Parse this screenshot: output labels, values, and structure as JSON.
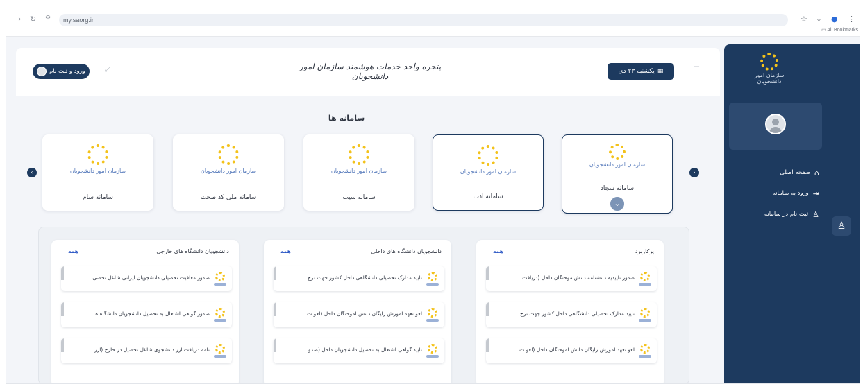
{
  "browser": {
    "url": "my.saorg.ir",
    "bookmarks_label": "All Bookmarks",
    "icons": [
      "arrow-right-icon",
      "reload-icon",
      "site-settings-icon",
      "star-icon",
      "download-icon",
      "profile-icon",
      "menu-icon"
    ]
  },
  "header": {
    "login_label": "ورود و ثبت نام",
    "title": "پنجره واحد خدمات هوشمند سازمان امور دانشجویان",
    "date_label": "یکشنبه ۲۳ دی"
  },
  "sidebar": {
    "logo_text": "سازمان امور دانشجویان",
    "menu": [
      {
        "label": "صفحه اصلی",
        "icon": "home-icon"
      },
      {
        "label": "ورود به سامانه",
        "icon": "login-icon"
      },
      {
        "label": "ثبت نام در سامانه",
        "icon": "user-add-icon"
      }
    ]
  },
  "systems": {
    "title": "سامانه ها",
    "logo_text": "سازمان امور دانشجویان",
    "cards": [
      {
        "name": "سامانه سجاد",
        "active": true
      },
      {
        "name": "سامانه ادب",
        "active": true
      },
      {
        "name": "سامانه سیب",
        "active": false
      },
      {
        "name": "سامانه ملی کد صحت",
        "active": false
      },
      {
        "name": "سامانه سام",
        "active": false
      }
    ]
  },
  "columns": [
    {
      "title": "پرکاربرد",
      "all_label": "همه",
      "items": [
        "صدور تاییدیه دانشنامه دانش‌آموختگان داخل (دریافت",
        "تایید مدارک تحصیلی دانشگاهی داخل کشور جهت ترج",
        "لغو تعهد آموزش رایگان دانش آموختگان داخل (لغو ت"
      ]
    },
    {
      "title": "دانشجویان دانشگاه های داخلی",
      "all_label": "همه",
      "items": [
        "تایید مدارک تحصیلی دانشگاهی داخل کشور جهت ترج",
        "لغو تعهد آموزش رایگان دانش آموختگان داخل (لغو ت",
        "تایید گواهی اشتغال به تحصیل دانشجویان داخل (صدو"
      ]
    },
    {
      "title": "دانشجویان دانشگاه های خارجی",
      "all_label": "همه",
      "items": [
        "صدور معافیت تحصیلی دانشجویان ایرانی شاغل تحصی",
        "صدور گواهی اشتغال به تحصیل دانشجویان دانشگاه ه",
        "نامه دریافت ارز دانشجوی شاغل تحصیل در خارج (ارز"
      ]
    }
  ]
}
